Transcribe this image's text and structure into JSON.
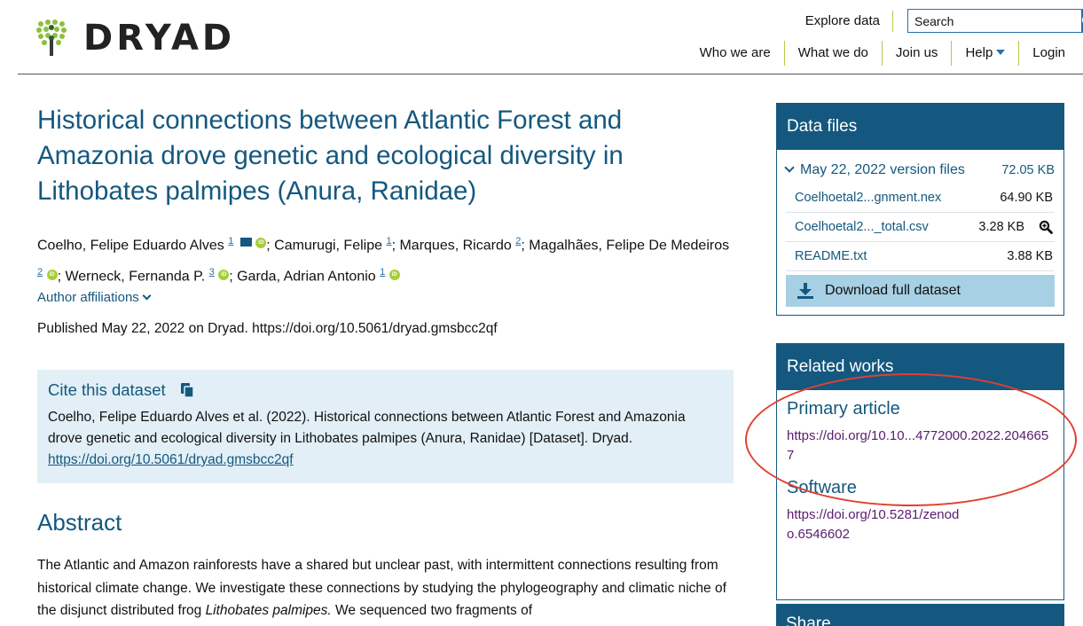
{
  "header": {
    "logo_text": "DRYAD",
    "explore": "Explore data",
    "search_placeholder": "Search",
    "nav": [
      "Who we are",
      "What we do",
      "Join us",
      "Help",
      "Login"
    ]
  },
  "article": {
    "title": "Historical connections between Atlantic Forest and Amazonia drove genetic and ecological diversity in Lithobates palmipes (Anura, Ranidae)",
    "authors": [
      {
        "name": "Coelho, Felipe Eduardo Alves",
        "sup": "1"
      },
      {
        "name": "Camurugi, Felipe",
        "sup": "1"
      },
      {
        "name": "Marques, Ricardo",
        "sup": "2"
      },
      {
        "name": "Magalhães, Felipe De Medeiros",
        "sup": "2"
      },
      {
        "name": "Werneck, Fernanda P.",
        "sup": "3"
      },
      {
        "name": "Garda, Adrian Antonio",
        "sup": "1"
      }
    ],
    "affiliations_label": "Author affiliations",
    "published": "Published May 22, 2022 on Dryad. https://doi.org/10.5061/dryad.gmsbcc2qf"
  },
  "cite": {
    "heading": "Cite this dataset",
    "text": "Coelho, Felipe Eduardo Alves et al. (2022). Historical connections between Atlantic Forest and Amazonia drove genetic and ecological diversity in Lithobates palmipes (Anura, Ranidae) [Dataset]. Dryad. ",
    "link": "https://doi.org/10.5061/dryad.gmsbcc2qf"
  },
  "abstract": {
    "heading": "Abstract",
    "text_1": "The Atlantic and Amazon rainforests have a shared but unclear past, with intermittent connections resulting from historical climate change. We investigate these connections by studying the phylogeography and climatic niche of the disjunct distributed frog ",
    "text_italic": "Lithobates palmipes.",
    "text_2": " We sequenced two fragments of"
  },
  "data_files": {
    "heading": "Data files",
    "version_label": "May 22, 2022 version files",
    "version_size": "72.05 KB",
    "files": [
      {
        "name": "Coelhoetal2...gnment.nex",
        "size": "64.90 KB"
      },
      {
        "name": "Coelhoetal2..._total.csv",
        "size": "3.28 KB"
      },
      {
        "name": "README.txt",
        "size": "3.88 KB"
      }
    ],
    "download_label": "Download full dataset"
  },
  "related": {
    "heading": "Related works",
    "primary_heading": "Primary article",
    "primary_link": "https://doi.org/10.10...4772000.2022.2046657",
    "software_heading": "Software",
    "software_link": "https://doi.org/10.5281/zenodo.6546602"
  },
  "share": {
    "heading": "Share"
  },
  "colors": {
    "brand": "#14587f",
    "accent": "#a6ce39",
    "annotation": "#e2402f"
  }
}
